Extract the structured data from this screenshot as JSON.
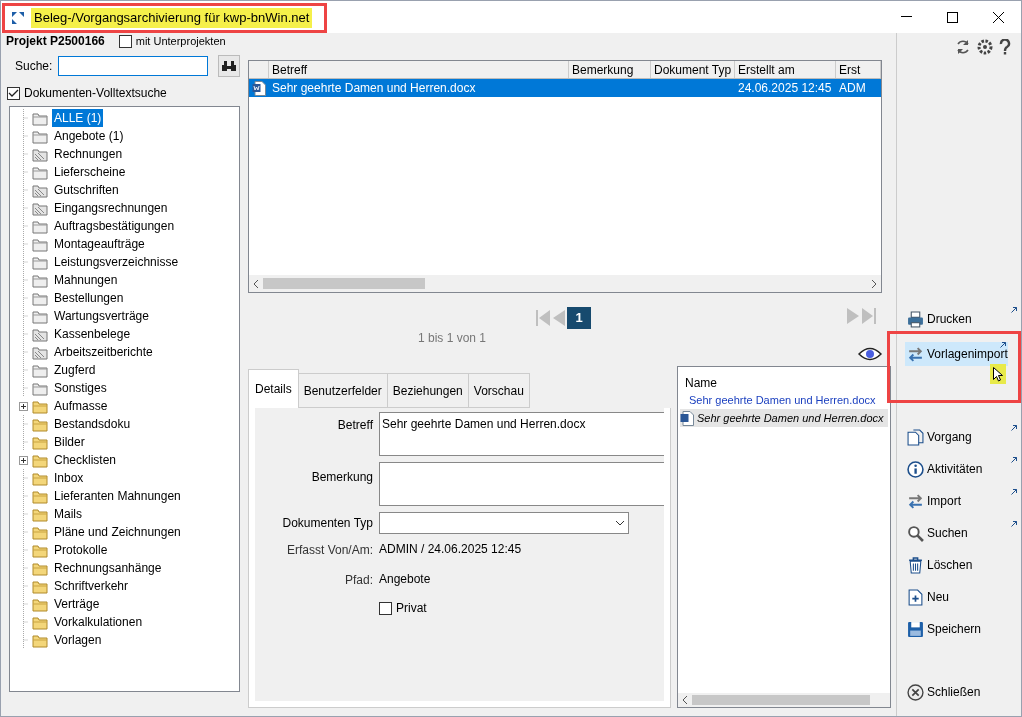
{
  "window": {
    "title": "Beleg-/Vorgangsarchivierung für kwp-bnWin.net"
  },
  "project": {
    "label": "Projekt P2500166",
    "sub_projects": {
      "label": "mit Unterprojekten",
      "checked": false
    }
  },
  "search": {
    "label": "Suche:"
  },
  "fulltext": {
    "label": "Dokumenten-Volltextsuche",
    "checked": true
  },
  "tree": [
    {
      "label": "ALLE (1)",
      "kind": "system",
      "selected": true,
      "collapsed": false
    },
    {
      "label": "Angebote (1)",
      "kind": "system",
      "selected": false,
      "collapsed": false
    },
    {
      "label": "Rechnungen",
      "kind": "locked",
      "selected": false,
      "collapsed": false
    },
    {
      "label": "Lieferscheine",
      "kind": "system",
      "selected": false,
      "collapsed": false
    },
    {
      "label": "Gutschriften",
      "kind": "locked",
      "selected": false,
      "collapsed": false
    },
    {
      "label": "Eingangsrechnungen",
      "kind": "locked",
      "selected": false,
      "collapsed": false
    },
    {
      "label": "Auftragsbestätigungen",
      "kind": "system",
      "selected": false,
      "collapsed": false
    },
    {
      "label": "Montageaufträge",
      "kind": "system",
      "selected": false,
      "collapsed": false
    },
    {
      "label": "Leistungsverzeichnisse",
      "kind": "system",
      "selected": false,
      "collapsed": false
    },
    {
      "label": "Mahnungen",
      "kind": "system",
      "selected": false,
      "collapsed": false
    },
    {
      "label": "Bestellungen",
      "kind": "system",
      "selected": false,
      "collapsed": false
    },
    {
      "label": "Wartungsverträge",
      "kind": "system",
      "selected": false,
      "collapsed": false
    },
    {
      "label": "Kassenbelege",
      "kind": "locked",
      "selected": false,
      "collapsed": false
    },
    {
      "label": "Arbeitszeitberichte",
      "kind": "locked",
      "selected": false,
      "collapsed": false
    },
    {
      "label": "Zugferd",
      "kind": "system",
      "selected": false,
      "collapsed": false
    },
    {
      "label": "Sonstiges",
      "kind": "system",
      "selected": false,
      "collapsed": false
    },
    {
      "label": "Aufmasse",
      "kind": "custom",
      "selected": false,
      "collapsed": true
    },
    {
      "label": "Bestandsdoku",
      "kind": "custom",
      "selected": false,
      "collapsed": false
    },
    {
      "label": "Bilder",
      "kind": "custom",
      "selected": false,
      "collapsed": false
    },
    {
      "label": "Checklisten",
      "kind": "custom",
      "selected": false,
      "collapsed": true
    },
    {
      "label": "Inbox",
      "kind": "custom",
      "selected": false,
      "collapsed": false
    },
    {
      "label": "Lieferanten Mahnungen",
      "kind": "custom",
      "selected": false,
      "collapsed": false
    },
    {
      "label": "Mails",
      "kind": "custom",
      "selected": false,
      "collapsed": false
    },
    {
      "label": "Pläne und Zeichnungen",
      "kind": "custom",
      "selected": false,
      "collapsed": false
    },
    {
      "label": "Protokolle",
      "kind": "custom",
      "selected": false,
      "collapsed": false
    },
    {
      "label": "Rechnungsanhänge",
      "kind": "custom",
      "selected": false,
      "collapsed": false
    },
    {
      "label": "Schriftverkehr",
      "kind": "custom",
      "selected": false,
      "collapsed": false
    },
    {
      "label": "Verträge",
      "kind": "custom",
      "selected": false,
      "collapsed": false
    },
    {
      "label": "Vorkalkulationen",
      "kind": "custom",
      "selected": false,
      "collapsed": false
    },
    {
      "label": "Vorlagen",
      "kind": "custom",
      "selected": false,
      "collapsed": false
    }
  ],
  "table": {
    "columns": [
      "Betreff",
      "Bemerkung",
      "Dokument Typ",
      "Erstellt am",
      "Erst"
    ],
    "rows": [
      {
        "cells": [
          "Sehr geehrte Damen und Herren.docx",
          "",
          "",
          "24.06.2025 12:45",
          "ADM"
        ],
        "selected": true
      }
    ]
  },
  "pager": {
    "page": "1",
    "summary": "1 bis 1 von 1"
  },
  "detail_tabs": [
    {
      "label": "Details",
      "selected": true
    },
    {
      "label": "Benutzerfelder",
      "selected": false
    },
    {
      "label": "Beziehungen",
      "selected": false
    },
    {
      "label": "Vorschau",
      "selected": false
    }
  ],
  "details": {
    "betreff": {
      "label": "Betreff",
      "value": "Sehr geehrte Damen und Herren.docx"
    },
    "bemerkung": {
      "label": "Bemerkung"
    },
    "typ": {
      "label": "Dokumenten Typ"
    },
    "erfasst": {
      "label": "Erfasst Von/Am:",
      "value": "ADMIN / 24.06.2025 12:45"
    },
    "pfad": {
      "label": "Pfad:",
      "value": "Angebote"
    },
    "privat": {
      "label": "Privat",
      "checked": false
    }
  },
  "files": {
    "header": "Name",
    "items": [
      {
        "label": "Sehr geehrte Damen und Herren.docx",
        "kind": "link"
      },
      {
        "label": "Sehr geehrte Damen und Herren.docx",
        "kind": "file"
      }
    ]
  },
  "actions": [
    {
      "label": "Drucken",
      "popout": true,
      "highlighted": false
    },
    {
      "label": "Vorlagenimport",
      "popout": true,
      "highlighted": true
    },
    {
      "label": "Vorgang",
      "popout": true,
      "highlighted": false
    },
    {
      "label": "Aktivitäten",
      "popout": true,
      "highlighted": false
    },
    {
      "label": "Import",
      "popout": true,
      "highlighted": false
    },
    {
      "label": "Suchen",
      "popout": true,
      "highlighted": false
    },
    {
      "label": "Löschen",
      "popout": false,
      "highlighted": false
    },
    {
      "label": "Neu",
      "popout": false,
      "highlighted": false
    },
    {
      "label": "Speichern",
      "popout": false,
      "highlighted": false
    },
    {
      "label": "Schließen",
      "popout": false,
      "highlighted": false
    }
  ]
}
